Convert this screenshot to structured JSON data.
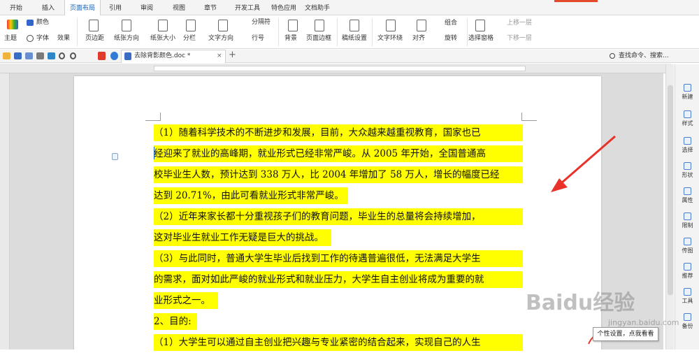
{
  "tabs": [
    "开始",
    "插入",
    "页面布局",
    "引用",
    "审阅",
    "视图",
    "章节",
    "开发工具",
    "特色应用",
    "文档助手"
  ],
  "ribbon": {
    "theme": "主题",
    "colors": "颜色",
    "fonts": "字体",
    "effects": "效果",
    "margins": "页边距",
    "orientation": "纸张方向",
    "size": "纸张大小",
    "columns": "分栏",
    "text_direction": "文字方向",
    "line_numbers": "行号",
    "breaks": "分隔符",
    "background": "背景",
    "page_border": "页面边框",
    "manuscript": "稿纸设置",
    "wrap": "文字环绕",
    "align": "对齐",
    "group": "组合",
    "rotate": "旋转",
    "selection_pane": "选择窗格",
    "bring_forward": "上移一层",
    "send_backward": "下移一层"
  },
  "document": {
    "filename": "去除背影颜色.doc *",
    "search_placeholder": "查找命令、搜索..."
  },
  "sidebar": [
    "新建",
    "样式",
    "选择",
    "形状",
    "属性",
    "限制",
    "传图",
    "推荐",
    "工具",
    "备份"
  ],
  "lines": [
    "（1）随着科学技术的不断进步和发展，目前，大众越来越重视教育，国家也已",
    "经迎来了就业的高峰期，就业形式已经非常严峻。从 2005 年开始，全国普通高",
    "校毕业生人数，预计达到 338 万人，比 2004 年增加了 58 万人，增长的幅度已经",
    "达到 20.71%，由此可看就业形式非常严峻。",
    "（2）近年来家长都十分重视孩子们的教育问题，毕业生的总量将会持续增加，",
    "这对毕业生就业工作无疑是巨大的挑战。",
    "（3）与此同时，普通大学生毕业后找到工作的待遇普遍很低，无法满足大学生",
    "的需求，面对如此严峻的就业形式和就业压力，大学生自主创业将成为重要的就",
    "业形式之一。",
    "2、目的:",
    "（1）大学生可以通过自主创业把兴趣与专业紧密的结合起来，实现自己的人生"
  ],
  "tooltip": "个性设置，点我看看",
  "watermark": "Baidu经验",
  "watermark_url": "jingyan.baidu.com",
  "colors": {
    "highlight": "#ffff00",
    "accent": "#1a5fb4",
    "arrow": "#e8322a"
  }
}
